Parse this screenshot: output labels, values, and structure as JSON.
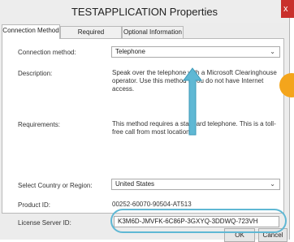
{
  "window": {
    "title": "TESTAPPLICATION Properties",
    "close_glyph": "x"
  },
  "tabs": [
    {
      "label": "Connection Method",
      "active": true
    },
    {
      "label": "Required Information",
      "active": false
    },
    {
      "label": "Optional Information",
      "active": false
    }
  ],
  "connection_method": {
    "label": "Connection method:",
    "value": "Telephone"
  },
  "description": {
    "label": "Description:",
    "text": "Speak over the telephone with a Microsoft Clearinghouse operator. Use this method if you do not have Internet access."
  },
  "requirements": {
    "label": "Requirements:",
    "text": "This method requires a standard telephone. This is a toll-free call from most locations."
  },
  "country": {
    "label": "Select Country or Region:",
    "value": "United States"
  },
  "product_id": {
    "label": "Product ID:",
    "value": "00252-60070-90504-AT513"
  },
  "license_server_id": {
    "label": "License Server ID:",
    "value": "K3M6D-JMVFK-6C86P-3GXYQ-3DDWQ-723VH"
  },
  "buttons": {
    "ok": "OK",
    "cancel": "Cancel"
  },
  "annotation": {
    "arrow_color": "#5fb8d4",
    "highlight_color": "#5fb8d4",
    "badge_color": "#f4a51c"
  }
}
